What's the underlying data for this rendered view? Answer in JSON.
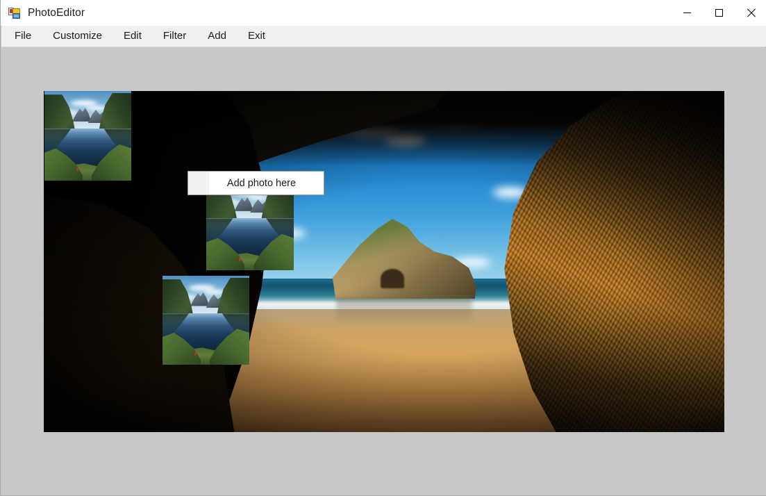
{
  "window": {
    "title": "PhotoEditor",
    "icon": "winforms-app-icon",
    "controls": {
      "minimize": "minimize-icon",
      "maximize": "maximize-icon",
      "close": "close-icon"
    }
  },
  "menu": {
    "items": [
      {
        "label": "File"
      },
      {
        "label": "Customize"
      },
      {
        "label": "Edit"
      },
      {
        "label": "Filter"
      },
      {
        "label": "Add"
      },
      {
        "label": "Exit"
      }
    ]
  },
  "canvas": {
    "name": "photo-canvas",
    "background_photo": "cave-arch-beach-photo",
    "thumbnails": [
      {
        "name": "thumbnail-1",
        "photo": "fjord-lake-mountains-photo"
      },
      {
        "name": "thumbnail-2",
        "photo": "fjord-lake-mountains-photo"
      },
      {
        "name": "thumbnail-3",
        "photo": "fjord-lake-mountains-photo"
      }
    ]
  },
  "add_photo_button": {
    "label": "Add photo here",
    "slot": "empty-photo-slot"
  },
  "colors": {
    "title_bar": "#ffffff",
    "menu_bar": "#f0f0f0",
    "client_background": "#c8c8c8",
    "canvas_background": "#000000",
    "button_background": "#ffffff",
    "button_border": "#9e9e9e",
    "text": "#1b1b1b"
  }
}
